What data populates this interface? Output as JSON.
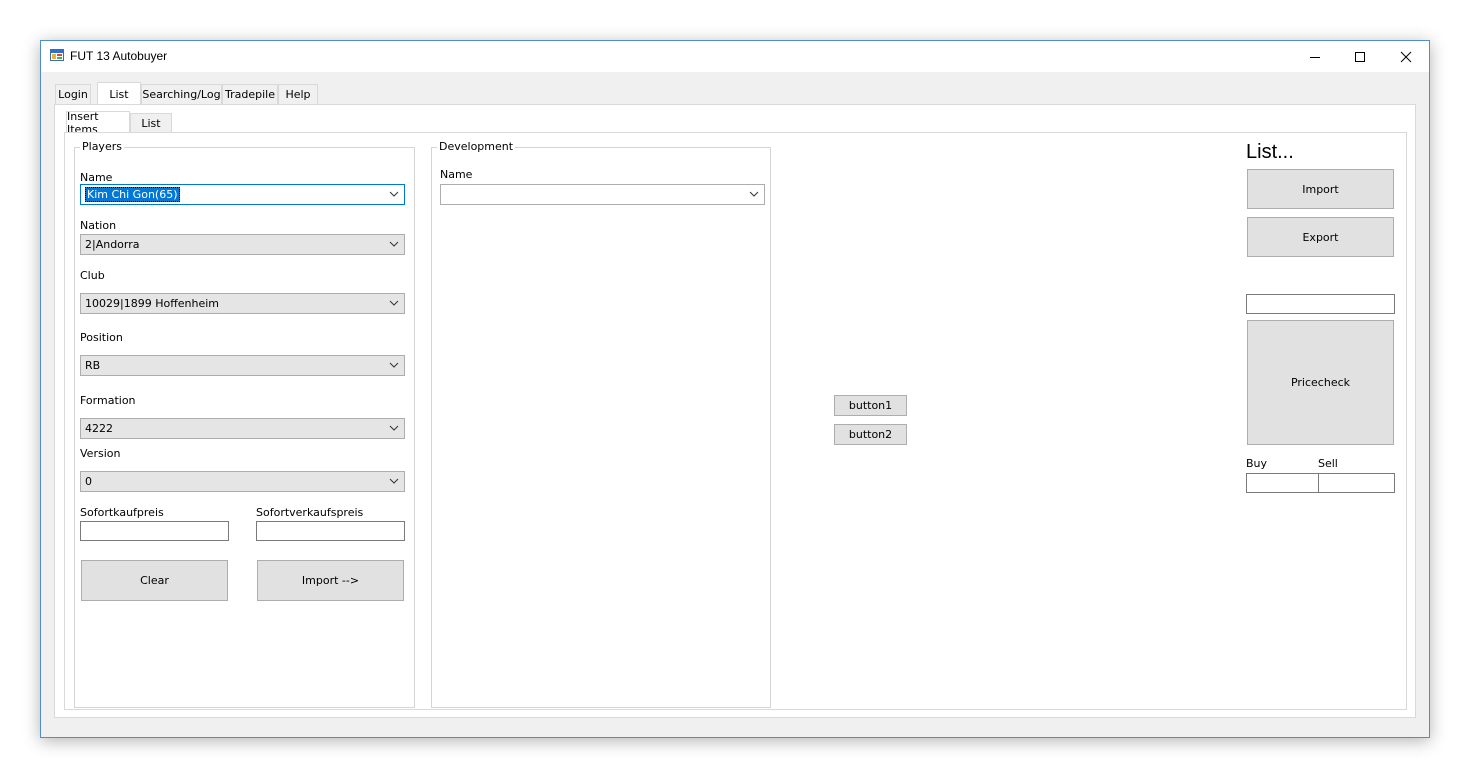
{
  "window": {
    "title": "FUT 13 Autobuyer",
    "icon": "app-window-icon"
  },
  "controls": {
    "minimize": "–",
    "maximize": "☐",
    "close": "✕"
  },
  "main_tabs": [
    "Login",
    "List",
    "Searching/Log",
    "Tradepile",
    "Help"
  ],
  "sub_tabs": [
    "Insert Items",
    "List"
  ],
  "players": {
    "legend": "Players",
    "name_label": "Name",
    "name_value": "Kim Chi Gon(65)",
    "nation_label": "Nation",
    "nation_value": "2|Andorra",
    "club_label": "Club",
    "club_value": "10029|1899 Hoffenheim",
    "position_label": "Position",
    "position_value": "RB",
    "formation_label": "Formation",
    "formation_value": "4222",
    "version_label": "Version",
    "version_value": "0",
    "buy_label": "Sofortkaufpreis",
    "buy_value": "",
    "sell_label": "Sofortverkaufspreis",
    "sell_value": "",
    "clear_button": "Clear",
    "import_button": "Import -->"
  },
  "development": {
    "legend": "Development",
    "name_label": "Name",
    "name_value": ""
  },
  "middle": {
    "button1": "button1",
    "button2": "button2"
  },
  "list_panel": {
    "heading": "List...",
    "import_button": "Import",
    "export_button": "Export",
    "search_value": "",
    "pricecheck_button": "Pricecheck",
    "buy_label": "Buy",
    "sell_label": "Sell",
    "buy_value": "",
    "sell_value": ""
  }
}
